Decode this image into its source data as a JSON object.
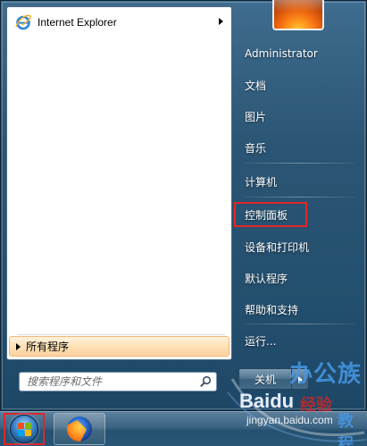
{
  "start_menu": {
    "pinned_programs": [
      {
        "label": "Internet Explorer",
        "icon": "internet-explorer-icon",
        "has_submenu": true
      }
    ],
    "all_programs_label": "所有程序",
    "search": {
      "placeholder": "搜索程序和文件",
      "value": ""
    },
    "right_column": {
      "user_name": "Administrator",
      "items": [
        {
          "label": "文档"
        },
        {
          "label": "图片"
        },
        {
          "label": "音乐"
        },
        {
          "label": "计算机"
        },
        {
          "label": "控制面板",
          "highlighted": true
        },
        {
          "label": "设备和打印机"
        },
        {
          "label": "默认程序"
        },
        {
          "label": "帮助和支持"
        },
        {
          "label": "运行..."
        }
      ]
    },
    "shutdown_label": "关机"
  },
  "taskbar": {
    "start_button_icon": "windows-orb-icon",
    "pinned_apps": [
      {
        "icon": "firefox-icon"
      }
    ]
  },
  "watermark": {
    "site_text": "办公族",
    "baidu_text": "Baidu",
    "jingyan_text": "经验",
    "url_text": "jingyan.baidu.com",
    "tutorial_text": "教程"
  },
  "colors": {
    "highlight_border": "#e02727",
    "all_programs_bg": "#fde1b6",
    "menu_glass": "#2b5574"
  }
}
